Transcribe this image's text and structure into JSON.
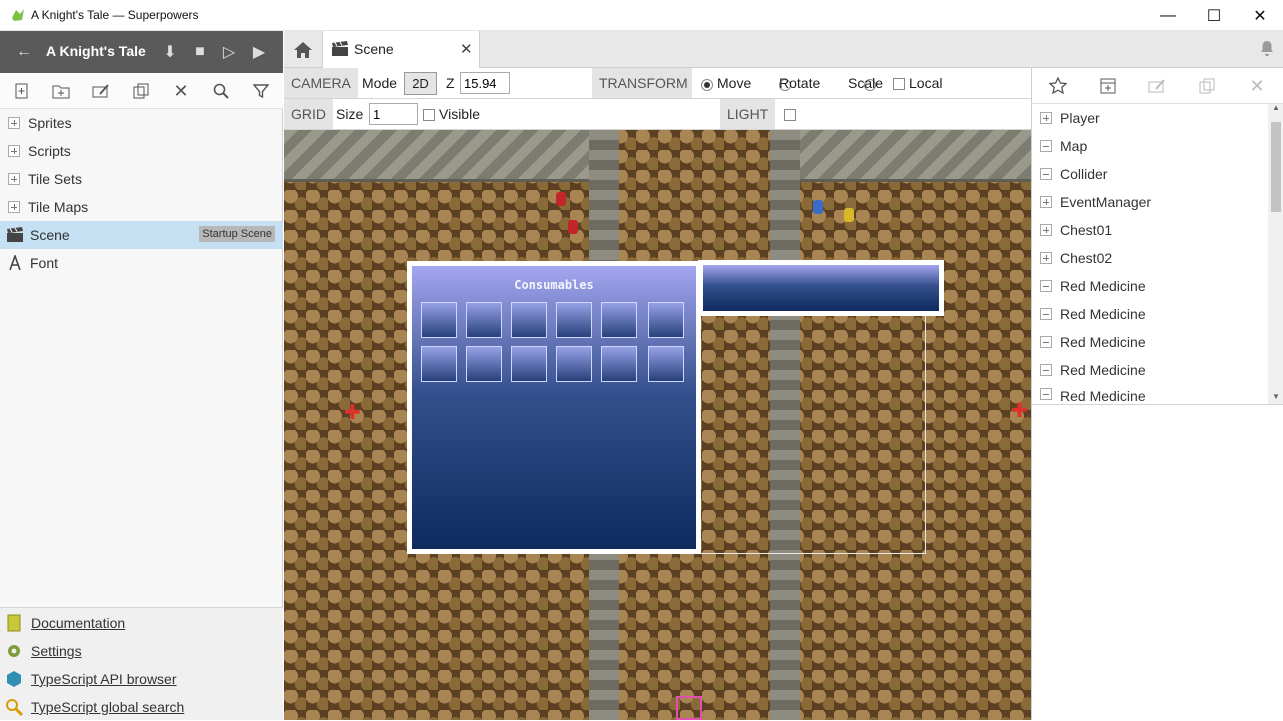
{
  "window": {
    "title": "A Knight's Tale — Superpowers"
  },
  "project": {
    "title": "A Knight's Tale"
  },
  "assets": [
    {
      "label": "Sprites",
      "type": "folder"
    },
    {
      "label": "Scripts",
      "type": "folder"
    },
    {
      "label": "Tile Sets",
      "type": "folder"
    },
    {
      "label": "Tile Maps",
      "type": "folder"
    },
    {
      "label": "Scene",
      "type": "scene",
      "badge": "Startup Scene"
    },
    {
      "label": "Font",
      "type": "font"
    }
  ],
  "footer": {
    "documentation": "Documentation",
    "settings": "Settings",
    "api_browser": "TypeScript API browser",
    "global_search": "TypeScript global search"
  },
  "tabs": {
    "scene": "Scene"
  },
  "camera": {
    "section": "CAMERA",
    "mode_label": "Mode",
    "mode_value": "2D",
    "z_label": "Z",
    "z_value": "15.94"
  },
  "transform": {
    "section": "TRANSFORM",
    "move": "Move",
    "rotate": "Rotate",
    "scale": "Scale",
    "local": "Local",
    "selected": "Move"
  },
  "grid": {
    "section": "GRID",
    "size_label": "Size",
    "size_value": "1",
    "visible_label": "Visible"
  },
  "light": {
    "section": "LIGHT"
  },
  "scene_text": {
    "panel_title": "Consumables"
  },
  "nodes": [
    {
      "label": "Player",
      "expanded": false
    },
    {
      "label": "Map",
      "expanded": true
    },
    {
      "label": "Collider",
      "expanded": true
    },
    {
      "label": "EventManager",
      "expanded": false
    },
    {
      "label": "Chest01",
      "expanded": false
    },
    {
      "label": "Chest02",
      "expanded": false
    },
    {
      "label": "Red Medicine",
      "expanded": true
    },
    {
      "label": "Red Medicine",
      "expanded": true
    },
    {
      "label": "Red Medicine",
      "expanded": true
    },
    {
      "label": "Red Medicine",
      "expanded": true
    },
    {
      "label": "Red Medicine",
      "expanded": true
    }
  ],
  "colors": {
    "selected_row": "#c5dff3",
    "header_bg": "#5a5a5a",
    "panel_blue": "#0f2a5e"
  }
}
